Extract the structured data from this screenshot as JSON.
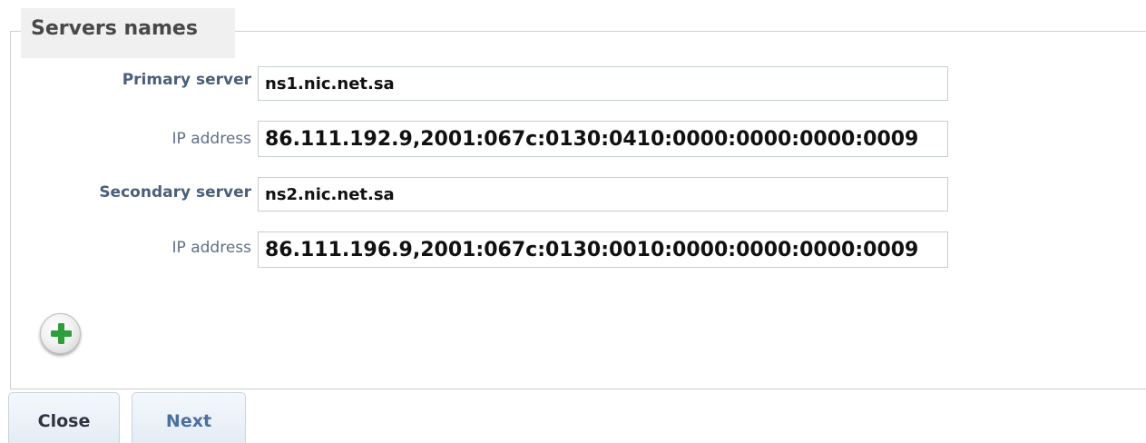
{
  "fieldset": {
    "legend": "Servers names"
  },
  "primary": {
    "label": "Primary server",
    "value": "ns1.nic.net.sa",
    "ip_label": "IP address",
    "ip_value": "86.111.192.9,2001:067c:0130:0410:0000:0000:0000:0009"
  },
  "secondary": {
    "label": "Secondary server",
    "value": "ns2.nic.net.sa",
    "ip_label": "IP address",
    "ip_value": "86.111.196.9,2001:067c:0130:0010:0000:0000:0000:0009"
  },
  "actions": {
    "add_icon": "plus-icon",
    "add_color": "#2e9e3a",
    "close_label": "Close",
    "next_label": "Next"
  }
}
